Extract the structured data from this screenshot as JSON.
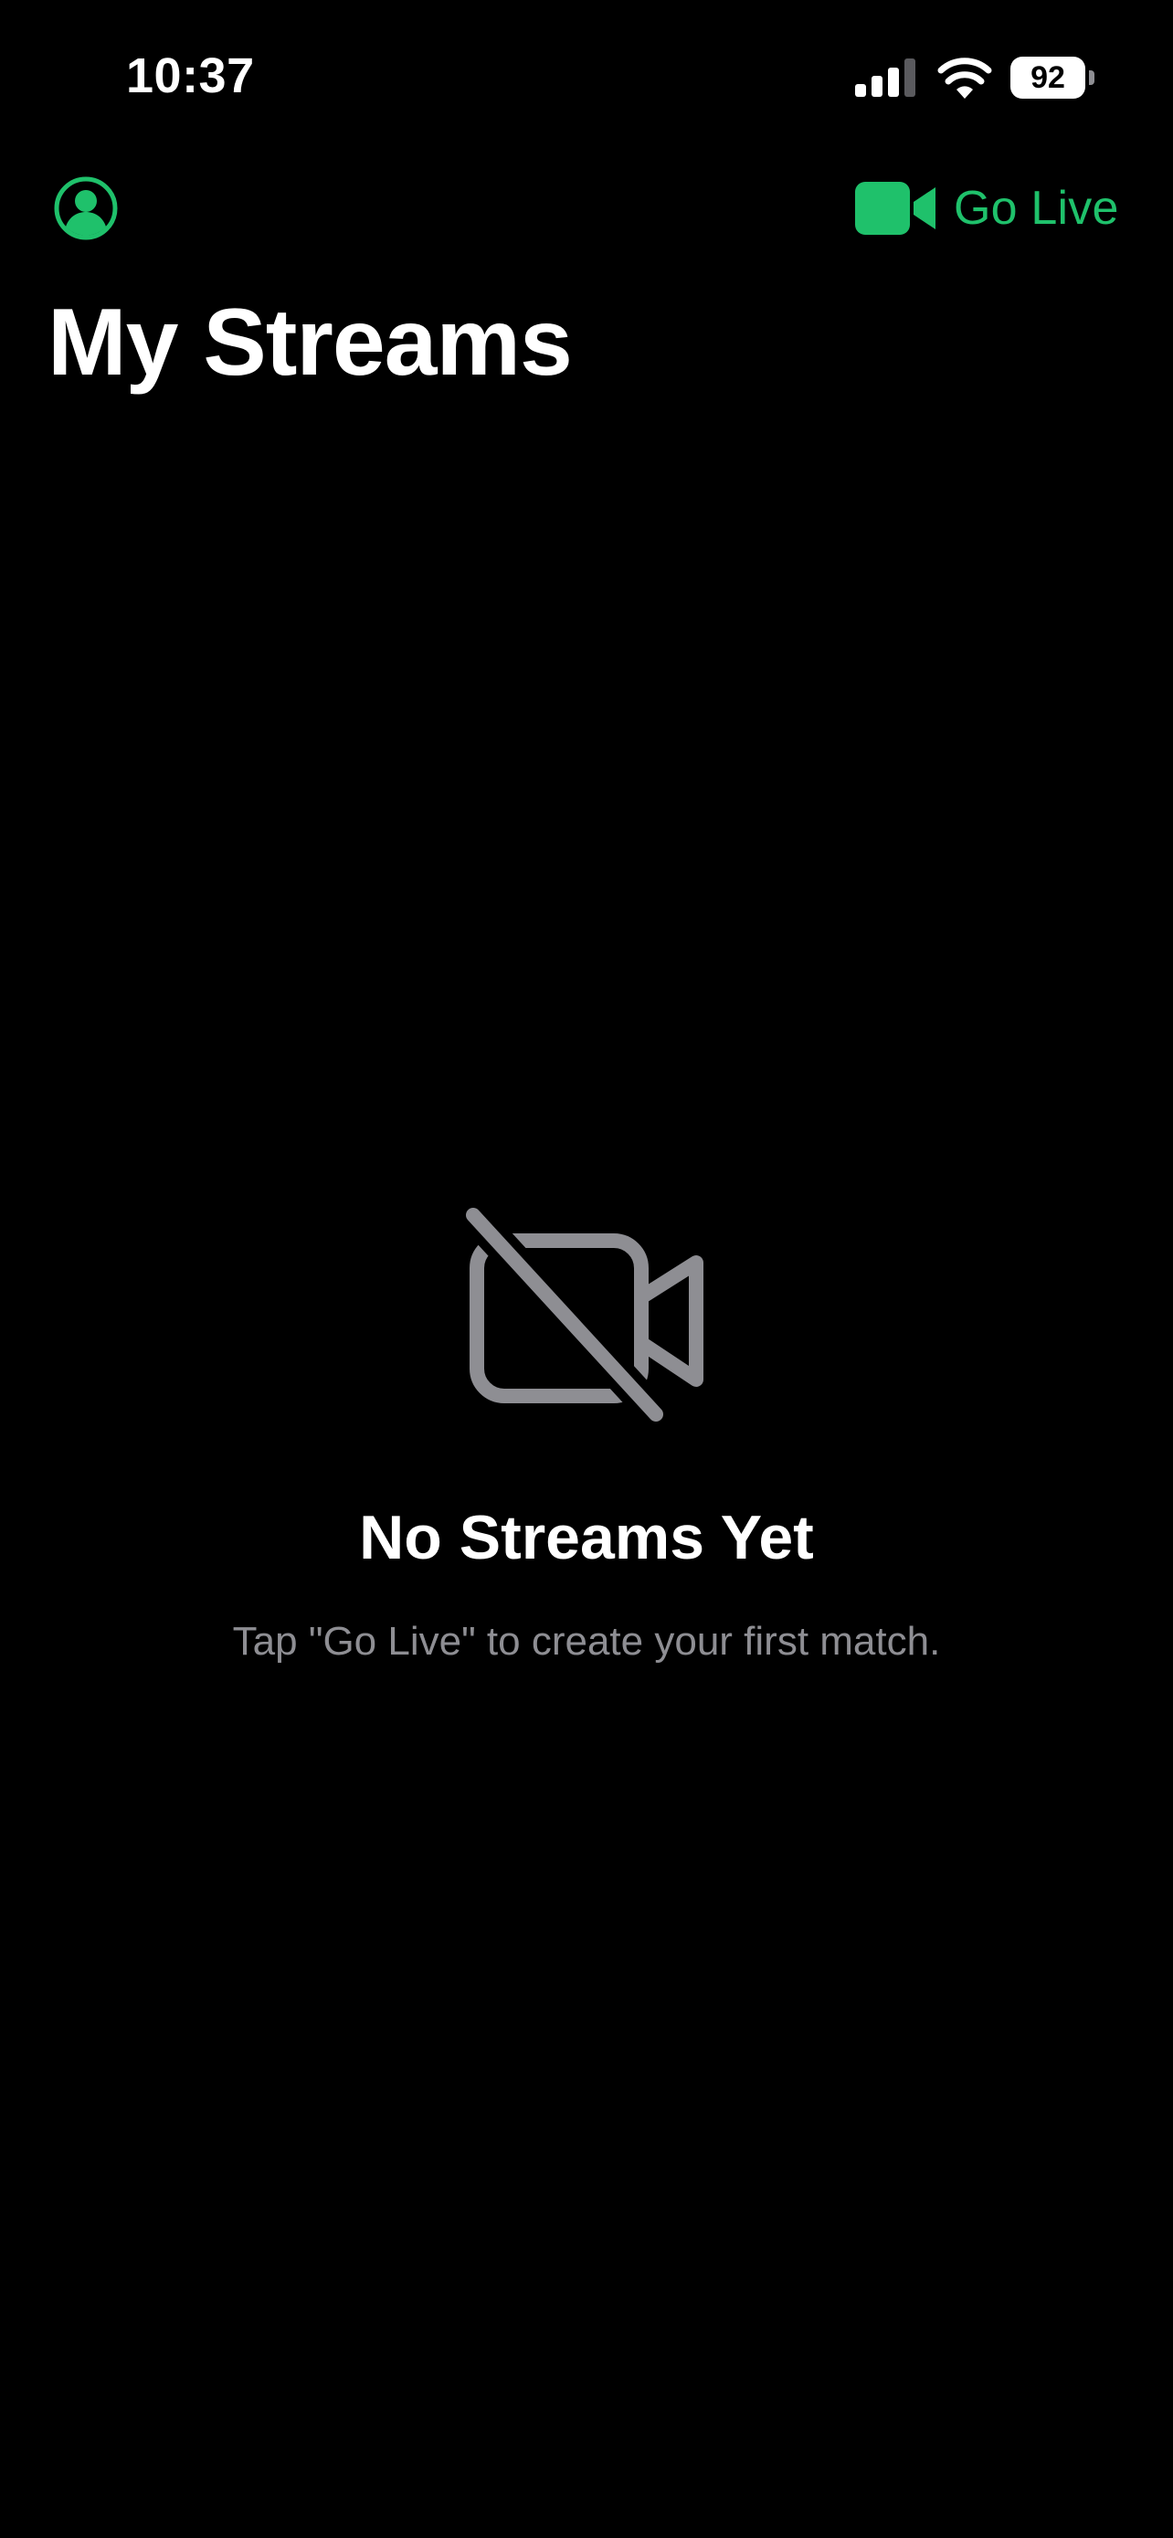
{
  "status_bar": {
    "time": "10:37",
    "battery_level": "92",
    "signal_icon": "cellular-signal-icon",
    "wifi_icon": "wifi-icon"
  },
  "nav": {
    "profile_icon": "person-circle-icon",
    "go_live_icon": "video-camera-fill-icon",
    "go_live_label": "Go Live"
  },
  "page": {
    "title": "My Streams"
  },
  "empty_state": {
    "icon": "video-slash-icon",
    "title": "No Streams Yet",
    "subtitle": "Tap \"Go Live\" to create your first match."
  },
  "colors": {
    "background": "#000000",
    "accent": "#1fc16b",
    "secondary_text": "#8e8e93",
    "primary_text": "#ffffff"
  }
}
